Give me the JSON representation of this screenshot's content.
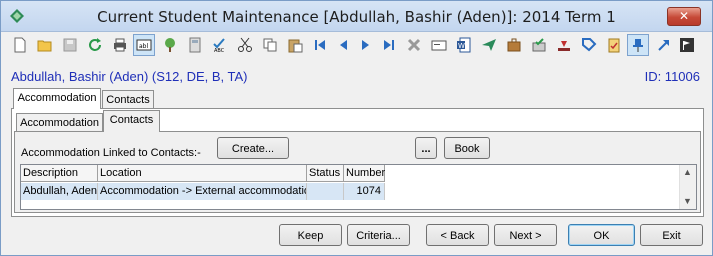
{
  "window": {
    "title": "Current Student Maintenance  [Abdullah, Bashir (Aden)]:  2014 Term 1",
    "close_label": "✕"
  },
  "toolbar": {
    "icons": [
      "new-icon",
      "open-icon",
      "save-icon",
      "refresh-icon",
      "print-icon",
      "text-field-icon",
      "tree-icon",
      "calculator-icon",
      "spellcheck-icon",
      "cut-icon",
      "copy-icon",
      "paste-icon",
      "first-record-icon",
      "previous-record-icon",
      "next-record-icon",
      "last-record-icon",
      "delete-icon",
      "card-icon",
      "word-icon",
      "send-icon",
      "briefcase-icon",
      "approve-icon",
      "download-icon",
      "tag-icon",
      "clipboard-icon",
      "pin-icon",
      "arrow-icon",
      "flag-icon"
    ]
  },
  "student": {
    "name": "Abdullah, Bashir (Aden) (S12, DE, B, TA)",
    "id": "ID: 11006"
  },
  "outer_tabs": [
    "Accommodation",
    "Contacts"
  ],
  "inner_tabs": [
    "Accommodation",
    "Contacts"
  ],
  "section": {
    "label": "Accommodation Linked to Contacts:-",
    "create_button": "Create...",
    "ellipsis_button": "...",
    "book_button": "Book"
  },
  "grid": {
    "columns": [
      "Description",
      "Location",
      "Status",
      "Number"
    ],
    "rows": [
      [
        "Abdullah, Aden",
        "Accommodation -> External accommodation",
        "",
        "1074"
      ]
    ],
    "scroll_up": "▲",
    "scroll_down": "▼"
  },
  "footer": {
    "keep": "Keep",
    "criteria": "Criteria...",
    "back": "< Back",
    "next": "Next >",
    "ok": "OK",
    "exit": "Exit"
  }
}
